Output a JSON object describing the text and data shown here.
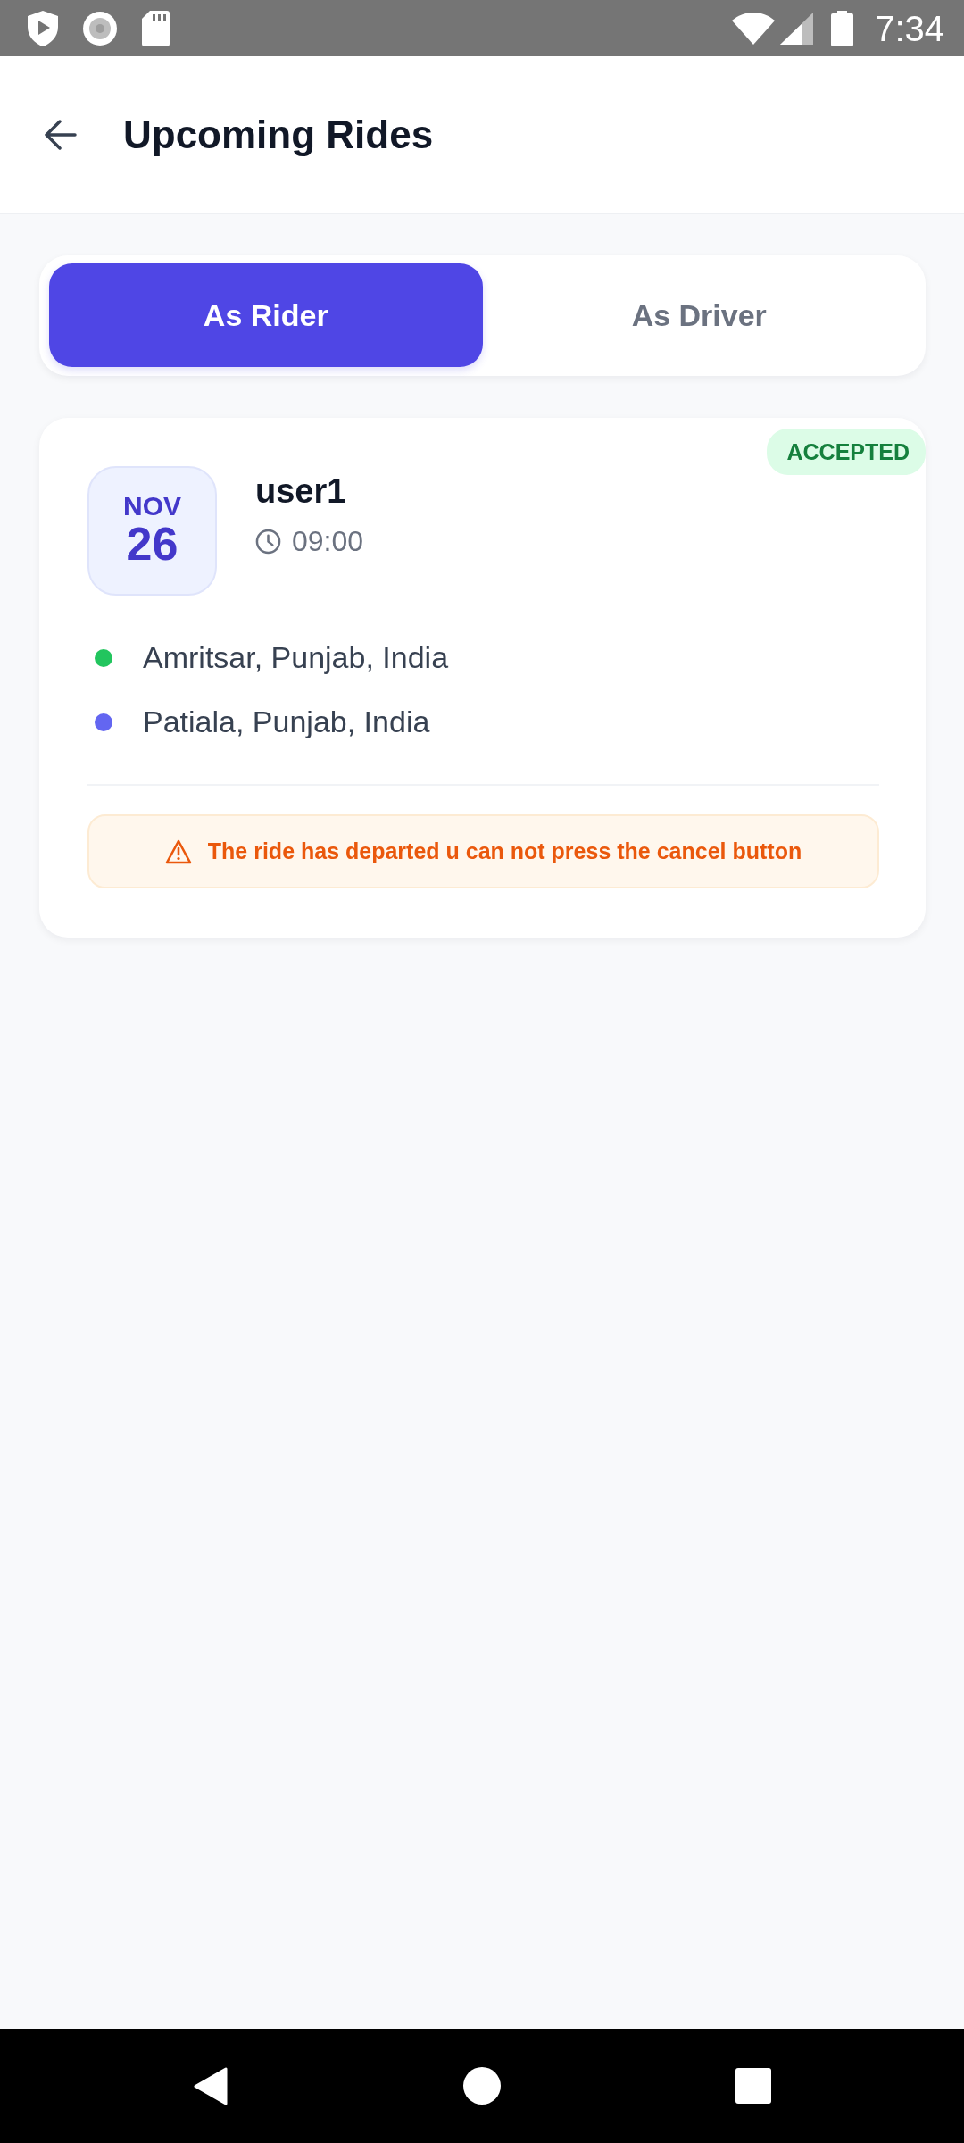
{
  "status_bar": {
    "time": "7:34"
  },
  "header": {
    "title": "Upcoming Rides"
  },
  "tabs": [
    {
      "label": "As Rider",
      "selected": true
    },
    {
      "label": "As Driver",
      "selected": false
    }
  ],
  "rides": [
    {
      "status": "ACCEPTED",
      "month": "NOV",
      "day": "26",
      "name": "user1",
      "time": "09:00",
      "stops": [
        {
          "place": "Amritsar, Punjab, India",
          "color": "#22c55e"
        },
        {
          "place": "Patiala, Punjab, India",
          "color": "#6366f1"
        }
      ],
      "notice": "The ride has departed u can not press the cancel button"
    }
  ]
}
